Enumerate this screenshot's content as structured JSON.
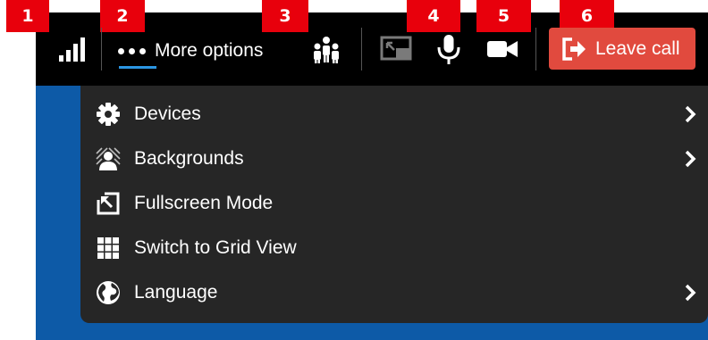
{
  "badges": [
    "1",
    "2",
    "3",
    "4",
    "5",
    "6"
  ],
  "toolbar": {
    "more_options_label": "More options",
    "leave_call_label": "Leave call",
    "accent_color": "#2b95e2",
    "leave_color": "#e14a3e"
  },
  "icons": {
    "signal": "signal-strength-icon",
    "more": "more-dots-icon",
    "participants": "participants-icon",
    "screenshare": "screen-share-icon",
    "mic": "microphone-icon",
    "camera": "camera-icon",
    "leave": "leave-icon"
  },
  "menu": {
    "items": [
      {
        "label": "Devices",
        "icon": "gear-icon",
        "has_submenu": true
      },
      {
        "label": "Backgrounds",
        "icon": "background-icon",
        "has_submenu": true
      },
      {
        "label": "Fullscreen Mode",
        "icon": "fullscreen-icon",
        "has_submenu": false
      },
      {
        "label": "Switch to Grid View",
        "icon": "grid-icon",
        "has_submenu": false
      },
      {
        "label": "Language",
        "icon": "globe-icon",
        "has_submenu": true
      }
    ]
  },
  "colors": {
    "badge": "#e8000c",
    "menu_bg": "#262626",
    "toolbar_bg": "#000000",
    "video_bg": "#0d5aa7"
  }
}
